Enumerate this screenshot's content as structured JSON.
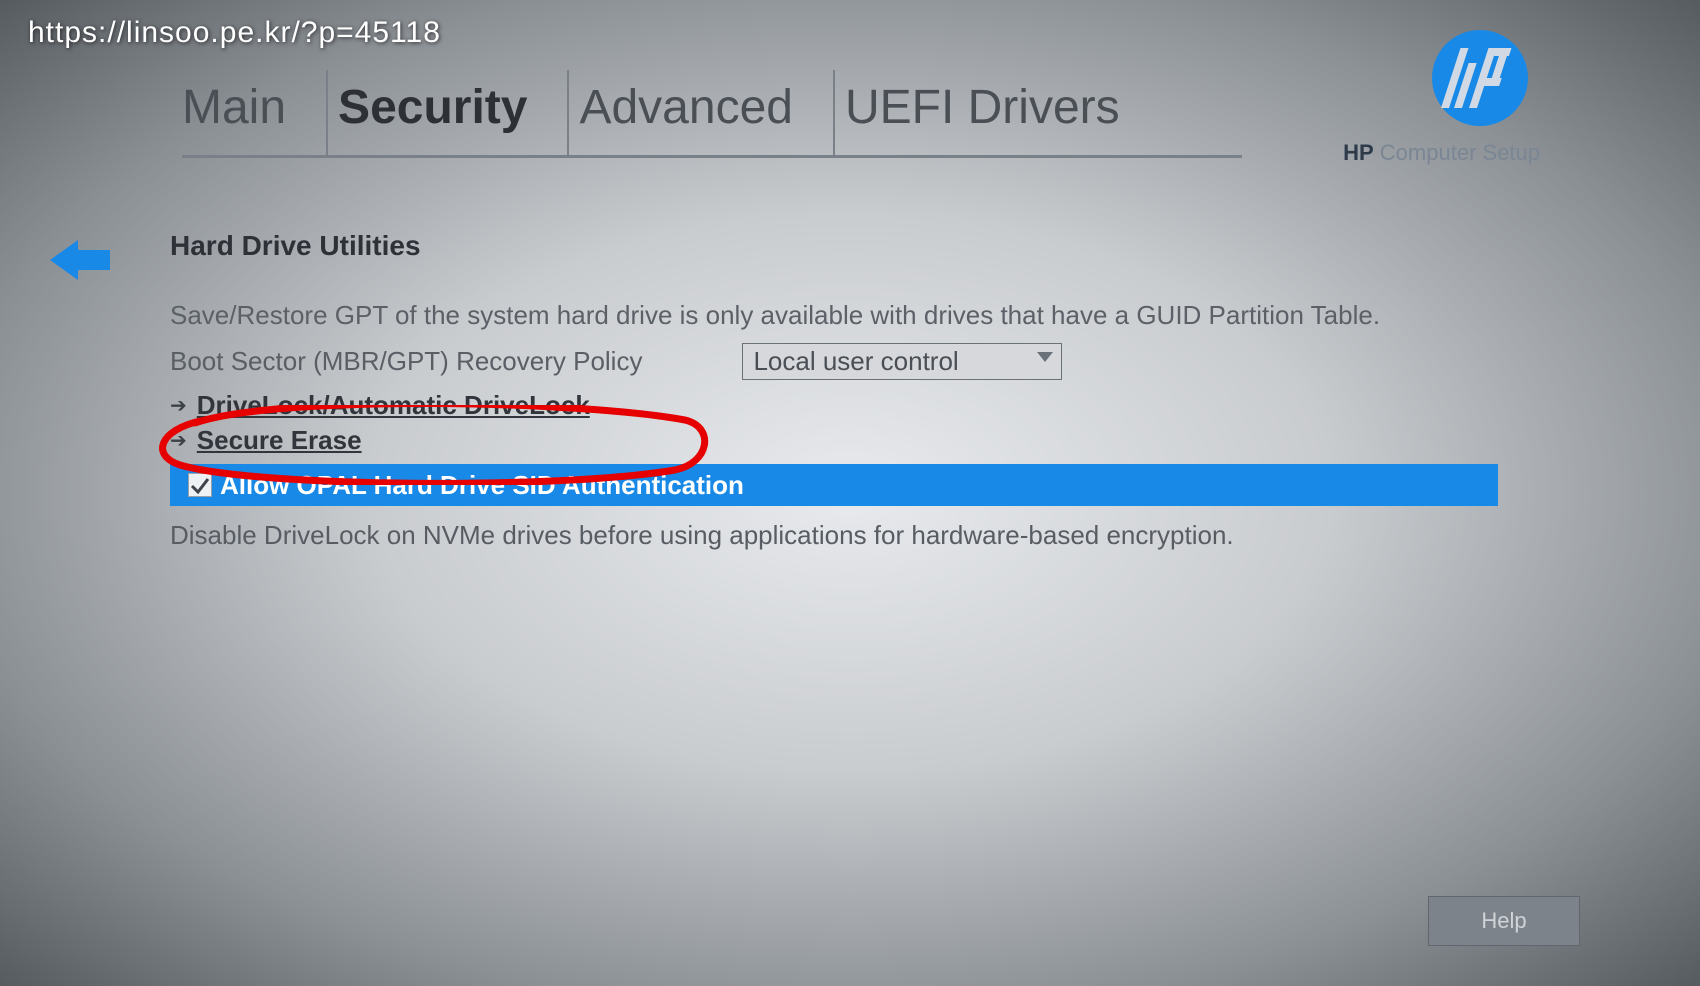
{
  "overlay_url": "https://linsoo.pe.kr/?p=45118",
  "tabs": [
    "Main",
    "Security",
    "Advanced",
    "UEFI Drivers"
  ],
  "active_tab_index": 1,
  "brand_bold": "HP",
  "brand_rest": "Computer Setup",
  "section_title": "Hard Drive Utilities",
  "gpt_note": "Save/Restore GPT of the system hard drive is only available with drives that have a GUID Partition Table.",
  "policy_label": "Boot Sector (MBR/GPT) Recovery Policy",
  "policy_value": "Local user control",
  "link1": "DriveLock/Automatic DriveLock",
  "link2": "Secure Erase",
  "opal_label": "Allow OPAL Hard Drive SID Authentication",
  "opal_checked": "true",
  "nvme_note": "Disable DriveLock on NVMe drives before using applications for hardware-based encryption.",
  "help_label": "Help"
}
